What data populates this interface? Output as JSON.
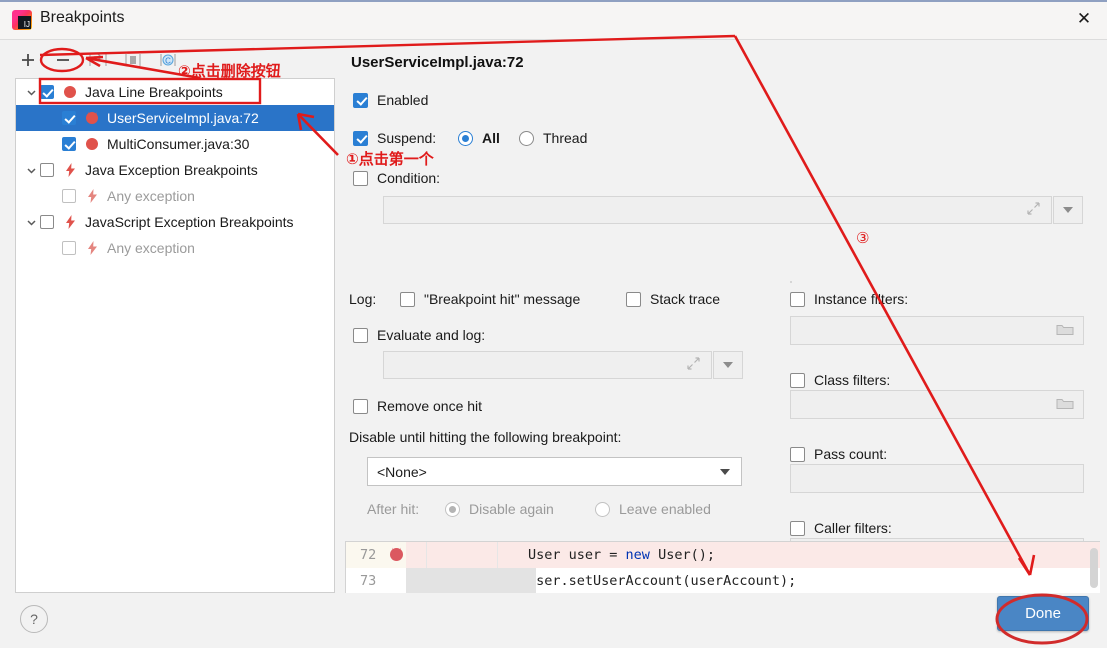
{
  "window": {
    "title": "Breakpoints",
    "logo_icon": "intellij-idea-logo",
    "close_icon": "close-icon"
  },
  "toolbar": {
    "add_label": "+",
    "remove_label": "−",
    "items": [
      {
        "name": "add-breakpoint-button",
        "glyph": "+"
      },
      {
        "name": "remove-breakpoint-button",
        "glyph": "−"
      },
      {
        "name": "mute-breakpoints-button",
        "glyph": "[⬅]"
      },
      {
        "name": "view-source-button",
        "glyph": "[▌]"
      },
      {
        "name": "group-by-class-button",
        "glyph": "[C]"
      }
    ]
  },
  "tree": {
    "nodes": [
      {
        "label": "Java Line Breakpoints",
        "checked": true,
        "expanded": true,
        "level": 0,
        "icon": "breakpoint-dot-icon",
        "muted": false,
        "selected": false
      },
      {
        "label": "UserServiceImpl.java:72",
        "checked": true,
        "expanded": null,
        "level": 1,
        "icon": "breakpoint-dot-icon",
        "muted": false,
        "selected": true
      },
      {
        "label": "MultiConsumer.java:30",
        "checked": true,
        "expanded": null,
        "level": 1,
        "icon": "breakpoint-dot-icon",
        "muted": false,
        "selected": false
      },
      {
        "label": "Java Exception Breakpoints",
        "checked": false,
        "expanded": true,
        "level": 0,
        "icon": "exception-bolt-icon",
        "muted": false,
        "selected": false
      },
      {
        "label": "Any exception",
        "checked": false,
        "expanded": null,
        "level": 1,
        "icon": "exception-bolt-icon",
        "muted": true,
        "selected": false
      },
      {
        "label": "JavaScript Exception Breakpoints",
        "checked": false,
        "expanded": true,
        "level": 0,
        "icon": "exception-bolt-icon",
        "muted": false,
        "selected": false
      },
      {
        "label": "Any exception",
        "checked": false,
        "expanded": null,
        "level": 1,
        "icon": "exception-bolt-icon",
        "muted": true,
        "selected": false
      }
    ]
  },
  "details": {
    "breakpoint_title": "UserServiceImpl.java:72",
    "enabled_label": "Enabled",
    "enabled_checked": true,
    "suspend_label": "Suspend:",
    "suspend_checked": true,
    "suspend_all_label": "All",
    "suspend_thread_label": "Thread",
    "suspend_selected": "All",
    "condition_label": "Condition:",
    "condition_checked": false,
    "condition_value": "",
    "log_label": "Log:",
    "log_message_label": "\"Breakpoint hit\" message",
    "log_message_checked": false,
    "stack_trace_label": "Stack trace",
    "stack_trace_checked": false,
    "evaluate_label": "Evaluate and log:",
    "evaluate_checked": false,
    "evaluate_value": "",
    "remove_once_hit_label": "Remove once hit",
    "remove_once_hit_checked": false,
    "disable_until_label": "Disable until hitting the following breakpoint:",
    "disable_until_value": "<None>",
    "after_hit_label": "After hit:",
    "after_hit_disable_label": "Disable again",
    "after_hit_leave_label": "Leave enabled",
    "after_hit_selected": "Disable again",
    "instance_filters_label": "Instance filters:",
    "instance_filters_checked": false,
    "instance_filters_value": "",
    "class_filters_label": "Class filters:",
    "class_filters_checked": false,
    "class_filters_value": "",
    "pass_count_label": "Pass count:",
    "pass_count_checked": false,
    "pass_count_value": "",
    "caller_filters_label": "Caller filters:",
    "caller_filters_checked": false,
    "caller_filters_value": ""
  },
  "code_preview": {
    "lines": [
      {
        "number": "72",
        "has_breakpoint": true,
        "text_plain": "User user = ",
        "keyword": "new",
        "text_after": " User();"
      },
      {
        "number": "73",
        "has_breakpoint": false,
        "text_plain": "user.setUserAccount(userAccount);",
        "keyword": "",
        "text_after": ""
      }
    ]
  },
  "footer": {
    "help_label": "?",
    "done_label": "Done"
  },
  "annotations": {
    "note_one": "①点击第一个",
    "note_two": "②点击删除按钮",
    "note_three": "③",
    "color": "#e01b1b"
  }
}
